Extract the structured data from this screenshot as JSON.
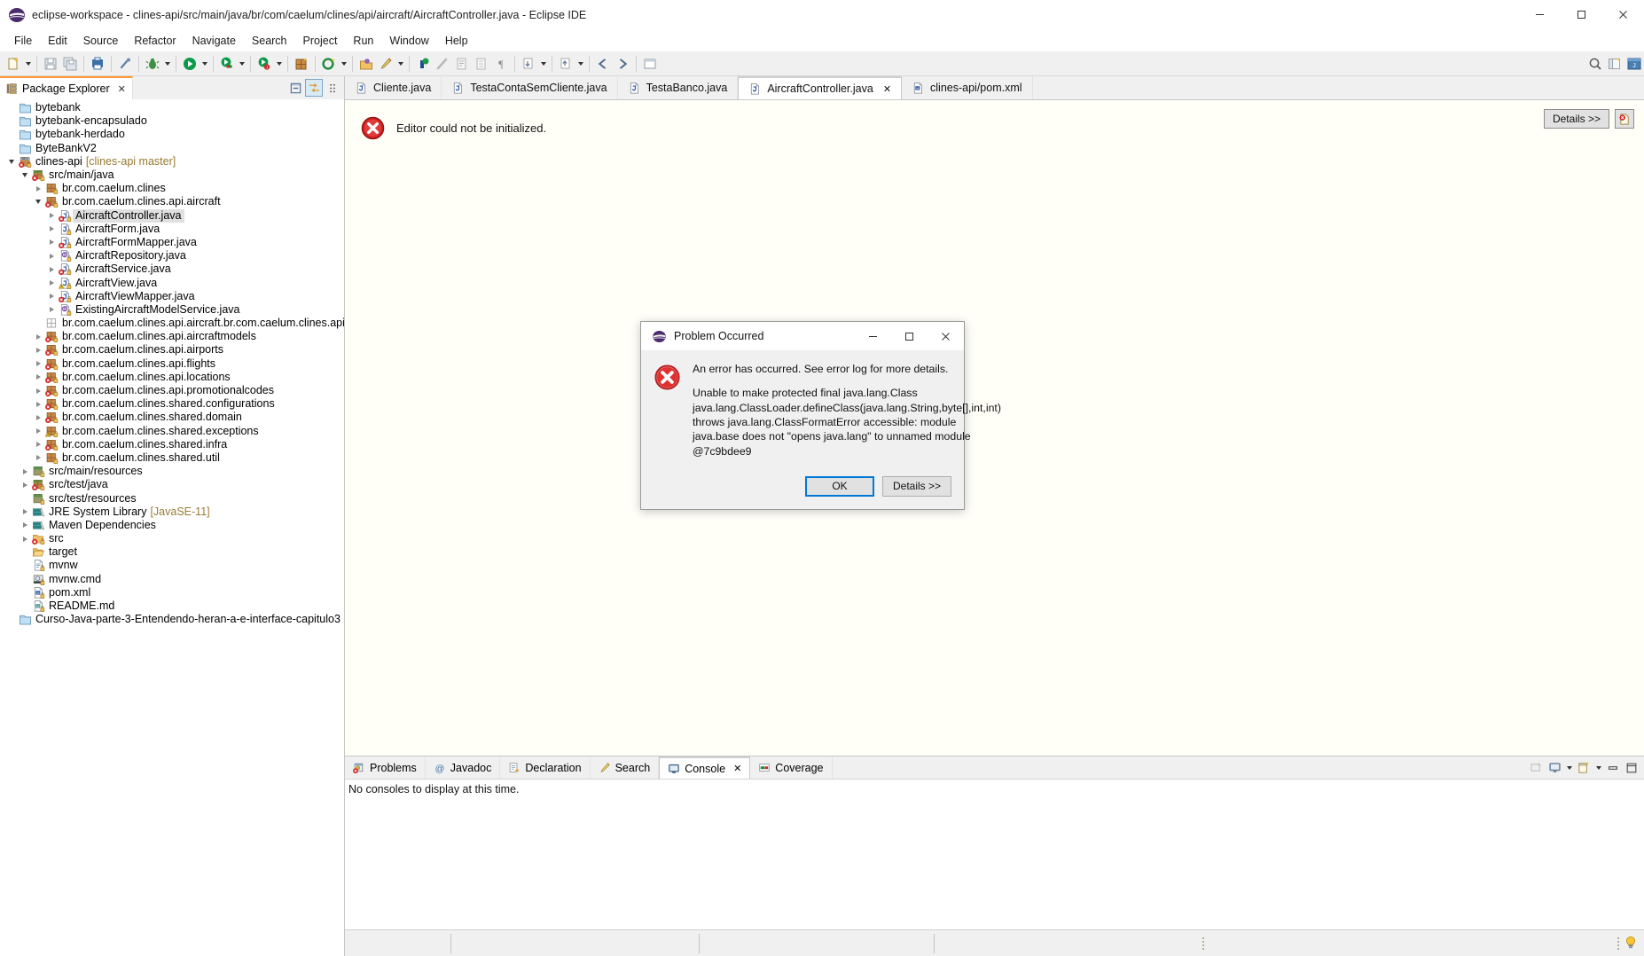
{
  "window": {
    "title": "eclipse-workspace - clines-api/src/main/java/br/com/caelum/clines/api/aircraft/AircraftController.java - Eclipse IDE",
    "minimize_label": "Minimize",
    "maximize_label": "Maximize",
    "close_label": "Close"
  },
  "menubar": {
    "items": [
      {
        "label": "File"
      },
      {
        "label": "Edit"
      },
      {
        "label": "Source"
      },
      {
        "label": "Refactor"
      },
      {
        "label": "Navigate"
      },
      {
        "label": "Search"
      },
      {
        "label": "Project"
      },
      {
        "label": "Run"
      },
      {
        "label": "Window"
      },
      {
        "label": "Help"
      }
    ]
  },
  "toolbar": {
    "buttons": [
      {
        "name": "new-wizard-icon",
        "tooltip": "New"
      },
      {
        "name": "save-icon",
        "tooltip": "Save"
      },
      {
        "name": "save-all-icon",
        "tooltip": "Save All"
      },
      {
        "name": "print-icon",
        "tooltip": "Print"
      },
      {
        "name": "link-icon",
        "tooltip": "Toggle Mark Occurrences"
      },
      {
        "name": "debug-icon",
        "tooltip": "Debug"
      },
      {
        "name": "run-icon",
        "tooltip": "Run"
      },
      {
        "name": "coverage-icon",
        "tooltip": "Coverage"
      },
      {
        "name": "run-config-icon",
        "tooltip": "Run Configurations"
      },
      {
        "name": "new-package-icon",
        "tooltip": "New Java Package"
      },
      {
        "name": "new-class-icon",
        "tooltip": "New Java Class"
      },
      {
        "name": "open-type-icon",
        "tooltip": "Open Type"
      },
      {
        "name": "search-icon",
        "tooltip": "Search"
      },
      {
        "name": "marker-icon",
        "tooltip": "Next Annotation"
      },
      {
        "name": "skip-icon",
        "tooltip": "Skip All Breakpoints"
      },
      {
        "name": "external-tools-icon",
        "tooltip": "External Tools"
      },
      {
        "name": "pilcrow-icon",
        "tooltip": "Show Whitespace"
      },
      {
        "name": "next-edit-icon",
        "tooltip": "Next Edit Location"
      },
      {
        "name": "prev-edit-icon",
        "tooltip": "Previous Edit Location"
      },
      {
        "name": "back-icon",
        "tooltip": "Back"
      },
      {
        "name": "forward-icon",
        "tooltip": "Forward"
      }
    ],
    "right_buttons": [
      {
        "name": "quick-access-search-icon",
        "tooltip": "Quick Access"
      },
      {
        "name": "open-perspective-icon",
        "tooltip": "Open Perspective"
      },
      {
        "name": "java-perspective-icon",
        "tooltip": "Java Perspective"
      }
    ]
  },
  "explorer": {
    "tab_label": "Package Explorer",
    "tab_icon": "package-explorer-icon",
    "close_label": "✕",
    "tools": [
      {
        "name": "collapse-all-icon",
        "tooltip": "Collapse All",
        "active": false
      },
      {
        "name": "link-with-editor-icon",
        "tooltip": "Link with Editor",
        "active": true
      },
      {
        "name": "view-menu-icon",
        "tooltip": "View Menu",
        "active": false
      }
    ],
    "tree": [
      {
        "label": "bytebank",
        "suffix": "",
        "indent": 0,
        "twist": "none",
        "icon": "project-closed-icon",
        "selected": false
      },
      {
        "label": "bytebank-encapsulado",
        "suffix": "",
        "indent": 0,
        "twist": "none",
        "icon": "project-closed-icon",
        "selected": false
      },
      {
        "label": "bytebank-herdado",
        "suffix": "",
        "indent": 0,
        "twist": "none",
        "icon": "project-closed-icon",
        "selected": false
      },
      {
        "label": "ByteBankV2",
        "suffix": "",
        "indent": 0,
        "twist": "none",
        "icon": "project-closed-icon",
        "selected": false
      },
      {
        "label": "clines-api",
        "suffix": "[clines-api master]",
        "indent": 0,
        "twist": "open",
        "icon": "java-project-error-icon",
        "selected": false
      },
      {
        "label": "src/main/java",
        "suffix": "",
        "indent": 1,
        "twist": "open",
        "icon": "source-folder-error-icon",
        "selected": false
      },
      {
        "label": "br.com.caelum.clines",
        "suffix": "",
        "indent": 2,
        "twist": "closed",
        "icon": "package-icon",
        "selected": false
      },
      {
        "label": "br.com.caelum.clines.api.aircraft",
        "suffix": "",
        "indent": 2,
        "twist": "open",
        "icon": "package-error-icon",
        "selected": false
      },
      {
        "label": "AircraftController.java",
        "suffix": "",
        "indent": 3,
        "twist": "closed",
        "icon": "java-file-error-icon",
        "selected": true
      },
      {
        "label": "AircraftForm.java",
        "suffix": "",
        "indent": 3,
        "twist": "closed",
        "icon": "java-file-icon",
        "selected": false
      },
      {
        "label": "AircraftFormMapper.java",
        "suffix": "",
        "indent": 3,
        "twist": "closed",
        "icon": "java-file-error-icon",
        "selected": false
      },
      {
        "label": "AircraftRepository.java",
        "suffix": "",
        "indent": 3,
        "twist": "closed",
        "icon": "java-interface-icon",
        "selected": false
      },
      {
        "label": "AircraftService.java",
        "suffix": "",
        "indent": 3,
        "twist": "closed",
        "icon": "java-file-error-icon",
        "selected": false
      },
      {
        "label": "AircraftView.java",
        "suffix": "",
        "indent": 3,
        "twist": "closed",
        "icon": "java-file-warning-icon",
        "selected": false
      },
      {
        "label": "AircraftViewMapper.java",
        "suffix": "",
        "indent": 3,
        "twist": "closed",
        "icon": "java-file-error-icon",
        "selected": false
      },
      {
        "label": "ExistingAircraftModelService.java",
        "suffix": "",
        "indent": 3,
        "twist": "closed",
        "icon": "java-interface-icon",
        "selected": false
      },
      {
        "label": "br.com.caelum.clines.api.aircraft.br.com.caelum.clines.api.aircraft",
        "suffix": "",
        "indent": 2,
        "twist": "none",
        "icon": "empty-package-icon",
        "selected": false
      },
      {
        "label": "br.com.caelum.clines.api.aircraftmodels",
        "suffix": "",
        "indent": 2,
        "twist": "closed",
        "icon": "package-error-icon",
        "selected": false
      },
      {
        "label": "br.com.caelum.clines.api.airports",
        "suffix": "",
        "indent": 2,
        "twist": "closed",
        "icon": "package-error-icon",
        "selected": false
      },
      {
        "label": "br.com.caelum.clines.api.flights",
        "suffix": "",
        "indent": 2,
        "twist": "closed",
        "icon": "package-error-icon",
        "selected": false
      },
      {
        "label": "br.com.caelum.clines.api.locations",
        "suffix": "",
        "indent": 2,
        "twist": "closed",
        "icon": "package-error-icon",
        "selected": false
      },
      {
        "label": "br.com.caelum.clines.api.promotionalcodes",
        "suffix": "",
        "indent": 2,
        "twist": "closed",
        "icon": "package-error-icon",
        "selected": false
      },
      {
        "label": "br.com.caelum.clines.shared.configurations",
        "suffix": "",
        "indent": 2,
        "twist": "closed",
        "icon": "package-error-icon",
        "selected": false
      },
      {
        "label": "br.com.caelum.clines.shared.domain",
        "suffix": "",
        "indent": 2,
        "twist": "closed",
        "icon": "package-error-icon",
        "selected": false
      },
      {
        "label": "br.com.caelum.clines.shared.exceptions",
        "suffix": "",
        "indent": 2,
        "twist": "closed",
        "icon": "package-warning-icon",
        "selected": false
      },
      {
        "label": "br.com.caelum.clines.shared.infra",
        "suffix": "",
        "indent": 2,
        "twist": "closed",
        "icon": "package-error-icon",
        "selected": false
      },
      {
        "label": "br.com.caelum.clines.shared.util",
        "suffix": "",
        "indent": 2,
        "twist": "closed",
        "icon": "package-icon",
        "selected": false
      },
      {
        "label": "src/main/resources",
        "suffix": "",
        "indent": 1,
        "twist": "closed",
        "icon": "resource-folder-icon",
        "selected": false
      },
      {
        "label": "src/test/java",
        "suffix": "",
        "indent": 1,
        "twist": "closed",
        "icon": "source-folder-error-icon",
        "selected": false
      },
      {
        "label": "src/test/resources",
        "suffix": "",
        "indent": 1,
        "twist": "none",
        "icon": "resource-folder-icon",
        "selected": false
      },
      {
        "label": "JRE System Library",
        "suffix": "[JavaSE-11]",
        "indent": 1,
        "twist": "closed",
        "icon": "library-icon",
        "selected": false
      },
      {
        "label": "Maven Dependencies",
        "suffix": "",
        "indent": 1,
        "twist": "closed",
        "icon": "library-icon",
        "selected": false
      },
      {
        "label": "src",
        "suffix": "",
        "indent": 1,
        "twist": "closed",
        "icon": "folder-error-icon",
        "selected": false
      },
      {
        "label": "target",
        "suffix": "",
        "indent": 1,
        "twist": "none",
        "icon": "folder-open-icon",
        "selected": false
      },
      {
        "label": "mvnw",
        "suffix": "",
        "indent": 1,
        "twist": "none",
        "icon": "file-icon",
        "selected": false
      },
      {
        "label": "mvnw.cmd",
        "suffix": "",
        "indent": 1,
        "twist": "none",
        "icon": "cmd-file-icon",
        "selected": false
      },
      {
        "label": "pom.xml",
        "suffix": "",
        "indent": 1,
        "twist": "none",
        "icon": "maven-file-icon",
        "selected": false
      },
      {
        "label": "README.md",
        "suffix": "",
        "indent": 1,
        "twist": "none",
        "icon": "markdown-file-icon",
        "selected": false
      },
      {
        "label": "Curso-Java-parte-3-Entendendo-heran-a-e-interface-capitulo3",
        "suffix": "",
        "indent": 0,
        "twist": "none",
        "icon": "project-closed-icon",
        "selected": false
      }
    ]
  },
  "editor": {
    "tabs": [
      {
        "label": "Cliente.java",
        "icon": "java-file-icon",
        "active": false,
        "closable": false
      },
      {
        "label": "TestaContaSemCliente.java",
        "icon": "java-file-icon",
        "active": false,
        "closable": false
      },
      {
        "label": "TestaBanco.java",
        "icon": "java-file-icon",
        "active": false,
        "closable": false
      },
      {
        "label": "AircraftController.java",
        "icon": "java-file-icon",
        "active": true,
        "closable": true
      },
      {
        "label": "clines-api/pom.xml",
        "icon": "maven-file-icon",
        "active": false,
        "closable": false
      }
    ],
    "close_label": "✕",
    "error_message": "Editor could not be initialized.",
    "error_icon": "error-circle-icon",
    "details_button": "Details >>",
    "error_log_icon": "error-log-icon"
  },
  "console": {
    "tabs": [
      {
        "label": "Problems",
        "icon": "problems-icon",
        "active": false,
        "closable": false
      },
      {
        "label": "Javadoc",
        "icon": "javadoc-at-icon",
        "active": false,
        "closable": false
      },
      {
        "label": "Declaration",
        "icon": "declaration-icon",
        "active": false,
        "closable": false
      },
      {
        "label": "Search",
        "icon": "search-pencil-icon",
        "active": false,
        "closable": false
      },
      {
        "label": "Console",
        "icon": "console-monitor-icon",
        "active": true,
        "closable": true
      },
      {
        "label": "Coverage",
        "icon": "coverage-icon",
        "active": false,
        "closable": false
      }
    ],
    "close_label": "✕",
    "empty_message": "No consoles to display at this time.",
    "tools": [
      {
        "name": "clear-console-icon",
        "tooltip": "Clear Console"
      },
      {
        "name": "display-selected-console-icon",
        "tooltip": "Display Selected Console"
      },
      {
        "name": "display-console-dropdown-icon",
        "tooltip": "Open Console"
      },
      {
        "name": "new-console-view-icon",
        "tooltip": "New Console View"
      },
      {
        "name": "new-console-dropdown-icon",
        "tooltip": "Open Console Menu"
      },
      {
        "name": "minimize-icon",
        "tooltip": "Minimize"
      },
      {
        "name": "maximize-icon",
        "tooltip": "Maximize"
      }
    ]
  },
  "statusbar": {
    "cells": [
      "",
      "",
      "",
      ""
    ],
    "grip_icon": "resize-grip-icon",
    "tip_icon": "lightbulb-icon"
  },
  "dialog": {
    "title": "Problem Occurred",
    "title_icon": "eclipse-logo-icon",
    "error_icon": "error-circle-icon",
    "line1": "An error has occurred. See error log for more details.",
    "line2": "Unable to make protected final java.lang.Class java.lang.ClassLoader.defineClass(java.lang.String,byte[],int,int) throws java.lang.ClassFormatError accessible: module java.base does not \"opens java.lang\" to unnamed module @7c9bdee9",
    "ok_label": "OK",
    "details_label": "Details >>",
    "minimize_label": "Minimize",
    "maximize_label": "Maximize",
    "close_label": "Close"
  },
  "colors": {
    "accent": "#0078d7",
    "error": "#d32020",
    "tab_active_top": "#ff9933",
    "suffix_text": "#9a7b32",
    "editor_bg": "#fffff8"
  }
}
